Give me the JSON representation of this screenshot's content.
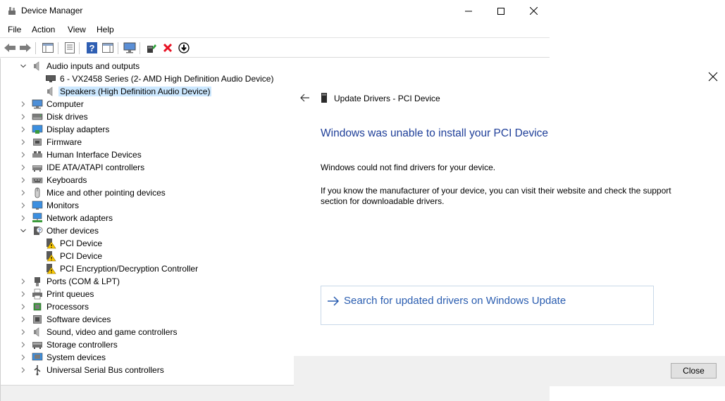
{
  "window": {
    "title": "Device Manager"
  },
  "menu": [
    "File",
    "Action",
    "View",
    "Help"
  ],
  "tree": [
    {
      "label": "Audio inputs and outputs",
      "level": 0,
      "expanded": true,
      "icon": "speaker-icon",
      "name": "audio-inputs-outputs"
    },
    {
      "label": "6 - VX2458 Series (2- AMD High Definition Audio Device)",
      "level": 1,
      "icon": "monitor-dark-icon",
      "name": "audio-device-vx2458"
    },
    {
      "label": "Speakers (High Definition Audio Device)",
      "level": 1,
      "icon": "speaker-icon",
      "selected": true,
      "name": "audio-device-speakers"
    },
    {
      "label": "Computer",
      "level": 0,
      "icon": "computer-icon",
      "name": "computer"
    },
    {
      "label": "Disk drives",
      "level": 0,
      "icon": "disk-drive-icon",
      "name": "disk-drives"
    },
    {
      "label": "Display adapters",
      "level": 0,
      "icon": "display-adapter-icon",
      "name": "display-adapters"
    },
    {
      "label": "Firmware",
      "level": 0,
      "icon": "firmware-icon",
      "name": "firmware"
    },
    {
      "label": "Human Interface Devices",
      "level": 0,
      "icon": "hid-icon",
      "name": "human-interface-devices"
    },
    {
      "label": "IDE ATA/ATAPI controllers",
      "level": 0,
      "icon": "ide-controller-icon",
      "name": "ide-controllers"
    },
    {
      "label": "Keyboards",
      "level": 0,
      "icon": "keyboard-icon",
      "name": "keyboards"
    },
    {
      "label": "Mice and other pointing devices",
      "level": 0,
      "icon": "mouse-icon",
      "name": "mice"
    },
    {
      "label": "Monitors",
      "level": 0,
      "icon": "monitor-icon",
      "name": "monitors"
    },
    {
      "label": "Network adapters",
      "level": 0,
      "icon": "network-adapter-icon",
      "name": "network-adapters"
    },
    {
      "label": "Other devices",
      "level": 0,
      "expanded": true,
      "icon": "unknown-device-icon",
      "name": "other-devices"
    },
    {
      "label": "PCI Device",
      "level": 1,
      "icon": "warning-device-icon",
      "name": "pci-device-1"
    },
    {
      "label": "PCI Device",
      "level": 1,
      "icon": "warning-device-icon",
      "name": "pci-device-2"
    },
    {
      "label": "PCI Encryption/Decryption Controller",
      "level": 1,
      "icon": "warning-device-icon",
      "name": "pci-encryption-controller"
    },
    {
      "label": "Ports (COM & LPT)",
      "level": 0,
      "icon": "port-icon",
      "name": "ports"
    },
    {
      "label": "Print queues",
      "level": 0,
      "icon": "printer-icon",
      "name": "print-queues"
    },
    {
      "label": "Processors",
      "level": 0,
      "icon": "processor-icon",
      "name": "processors"
    },
    {
      "label": "Software devices",
      "level": 0,
      "icon": "software-device-icon",
      "name": "software-devices"
    },
    {
      "label": "Sound, video and game controllers",
      "level": 0,
      "icon": "speaker-icon",
      "name": "sound-video-game"
    },
    {
      "label": "Storage controllers",
      "level": 0,
      "icon": "storage-controller-icon",
      "name": "storage-controllers"
    },
    {
      "label": "System devices",
      "level": 0,
      "icon": "system-device-icon",
      "name": "system-devices"
    },
    {
      "label": "Universal Serial Bus controllers",
      "level": 0,
      "icon": "usb-icon",
      "name": "usb-controllers"
    }
  ],
  "dialog": {
    "title": "Update Drivers - PCI Device",
    "heading": "Windows was unable to install your PCI Device",
    "message1": "Windows could not find drivers for your device.",
    "message2": "If you know the manufacturer of your device, you can visit their website and check the support section for downloadable drivers.",
    "search_label": "Search for updated drivers on Windows Update",
    "close_label": "Close"
  },
  "colors": {
    "selection": "#cce8ff",
    "heading": "#1f3f99",
    "link": "#2a5db0",
    "error": "#e81123"
  }
}
